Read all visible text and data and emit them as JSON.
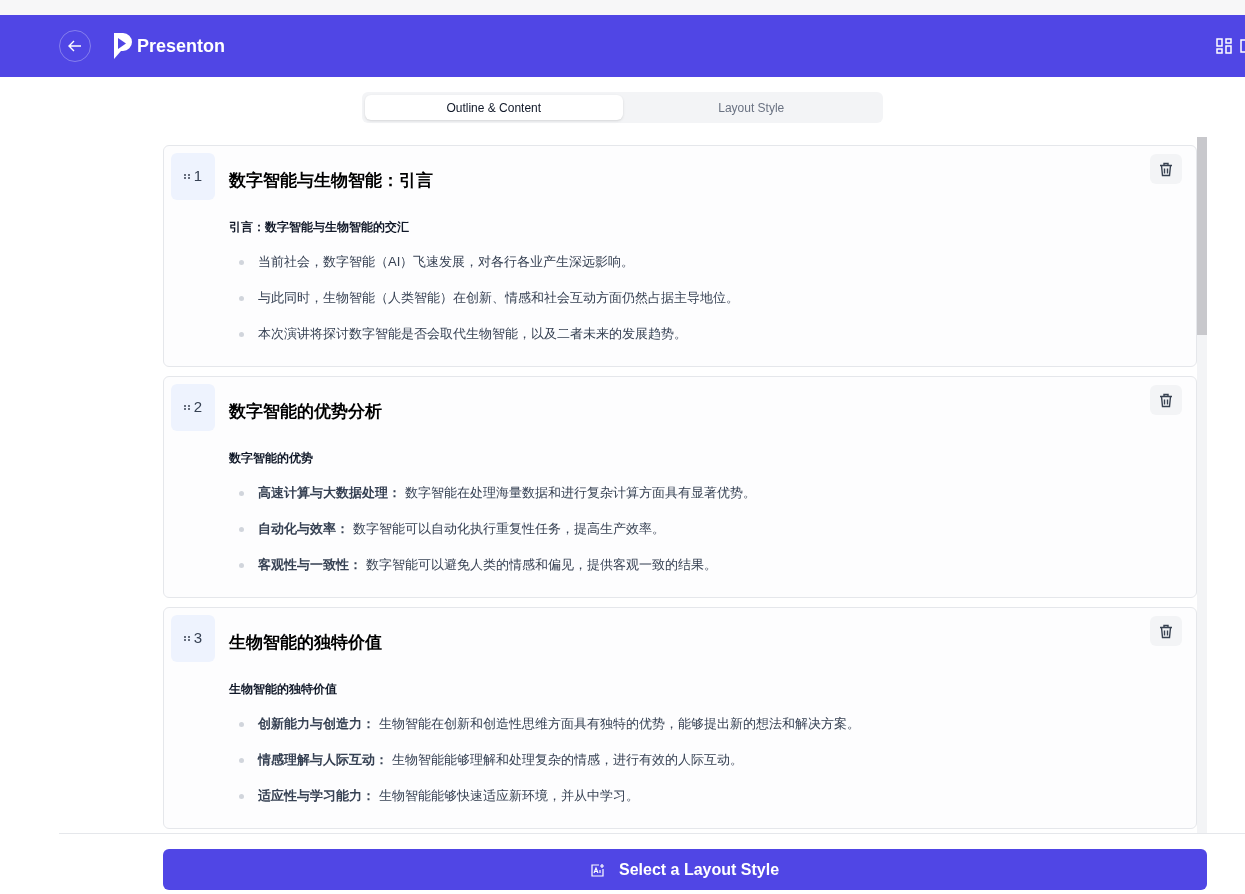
{
  "header": {
    "brand": "Presenton"
  },
  "tabs": [
    {
      "label": "Outline & Content",
      "selected": true
    },
    {
      "label": "Layout Style",
      "selected": false
    }
  ],
  "slides": [
    {
      "number": "1",
      "title": "数字智能与生物智能：引言",
      "subtitle": "引言：数字智能与生物智能的交汇",
      "bullets": [
        "当前社会，数字智能（AI）飞速发展，对各行各业产生深远影响。",
        "与此同时，生物智能（人类智能）在创新、情感和社会互动方面仍然占据主导地位。",
        "本次演讲将探讨数字智能是否会取代生物智能，以及二者未来的发展趋势。"
      ]
    },
    {
      "number": "2",
      "title": "数字智能的优势分析",
      "subtitle": "数字智能的优势",
      "bullets": [
        "**高速计算与大数据处理：** 数字智能在处理海量数据和进行复杂计算方面具有显著优势。",
        "**自动化与效率：** 数字智能可以自动化执行重复性任务，提高生产效率。",
        "**客观性与一致性：** 数字智能可以避免人类的情感和偏见，提供客观一致的结果。"
      ]
    },
    {
      "number": "3",
      "title": "生物智能的独特价值",
      "subtitle": "生物智能的独特价值",
      "bullets": [
        "**创新能力与创造力：** 生物智能在创新和创造性思维方面具有独特的优势，能够提出新的想法和解决方案。",
        "**情感理解与人际互动：** 生物智能能够理解和处理复杂的情感，进行有效的人际互动。",
        "**适应性与学习能力：** 生物智能能够快速适应新环境，并从中学习。"
      ]
    }
  ],
  "action_button": "Select a Layout Style"
}
